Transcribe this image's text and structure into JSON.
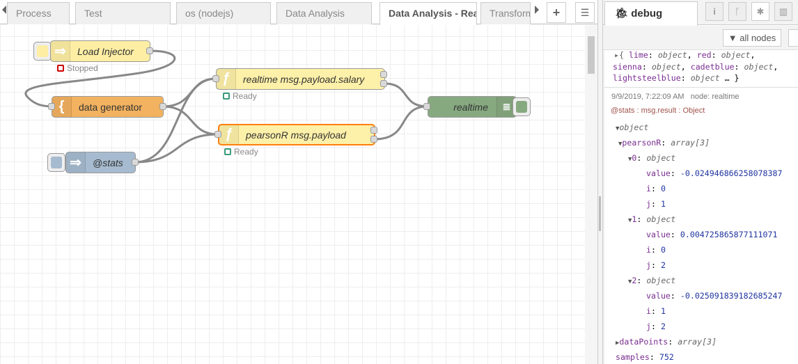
{
  "tabs": [
    {
      "label": "Process"
    },
    {
      "label": "Test"
    },
    {
      "label": "os (nodejs)"
    },
    {
      "label": "Data Analysis"
    },
    {
      "label": "Data Analysis - Realtime",
      "active": true
    },
    {
      "label": "Transform"
    }
  ],
  "tab_actions": {
    "add": "+",
    "list": "☰"
  },
  "nodes": {
    "load_injector": {
      "label": "Load Injector",
      "status": "Stopped",
      "color": "#fdeea4"
    },
    "data_generator": {
      "label": "data generator",
      "color": "#f2b25f"
    },
    "realtime_fn": {
      "label": "realtime msg.payload.salary",
      "status": "Ready",
      "color": "#fdf0a8"
    },
    "pearson_fn": {
      "label": "pearsonR msg.payload",
      "status": "Ready",
      "color": "#fdf0a8"
    },
    "stats": {
      "label": "@stats",
      "color": "#a6bbcf"
    },
    "realtime_debug": {
      "label": "realtime",
      "color": "#87a980"
    }
  },
  "sidebar": {
    "tab": "debug",
    "filter": "all nodes",
    "prev_message": {
      "line1_key1": "lime",
      "line1_key2": "red",
      "line2_key1": "sienna",
      "line2_key2": "cadetblue",
      "line3_key1": "lightsteelblue",
      "type": "object"
    },
    "message": {
      "timestamp": "9/9/2019, 7:22:09 AM",
      "node": "node: realtime",
      "topic": "@stats : msg.result : Object"
    },
    "tree": [
      {
        "indent": 0,
        "toggle": "open",
        "key": "",
        "val": "object",
        "kind": "t"
      },
      {
        "indent": 1,
        "toggle": "open",
        "key": "pearsonR",
        "val": "array[3]",
        "kind": "t"
      },
      {
        "indent": 2,
        "toggle": "open",
        "key": "0",
        "val": "object",
        "kind": "t"
      },
      {
        "indent": 3,
        "key": "value",
        "val": "-0.024946866258078387",
        "kind": "v"
      },
      {
        "indent": 3,
        "key": "i",
        "val": "0",
        "kind": "v"
      },
      {
        "indent": 3,
        "key": "j",
        "val": "1",
        "kind": "v"
      },
      {
        "indent": 2,
        "toggle": "open",
        "key": "1",
        "val": "object",
        "kind": "t"
      },
      {
        "indent": 3,
        "key": "value",
        "val": "0.004725865877111071",
        "kind": "v"
      },
      {
        "indent": 3,
        "key": "i",
        "val": "0",
        "kind": "v"
      },
      {
        "indent": 3,
        "key": "j",
        "val": "2",
        "kind": "v"
      },
      {
        "indent": 2,
        "toggle": "open",
        "key": "2",
        "val": "object",
        "kind": "t"
      },
      {
        "indent": 3,
        "key": "value",
        "val": "-0.025091839182685247",
        "kind": "v"
      },
      {
        "indent": 3,
        "key": "i",
        "val": "1",
        "kind": "v"
      },
      {
        "indent": 3,
        "key": "j",
        "val": "2",
        "kind": "v"
      },
      {
        "indent": 0,
        "toggle": "closed",
        "key": "dataPoints",
        "val": "array[3]",
        "kind": "t"
      },
      {
        "indent": 0,
        "key": "samples",
        "val": "752",
        "kind": "v"
      }
    ]
  }
}
